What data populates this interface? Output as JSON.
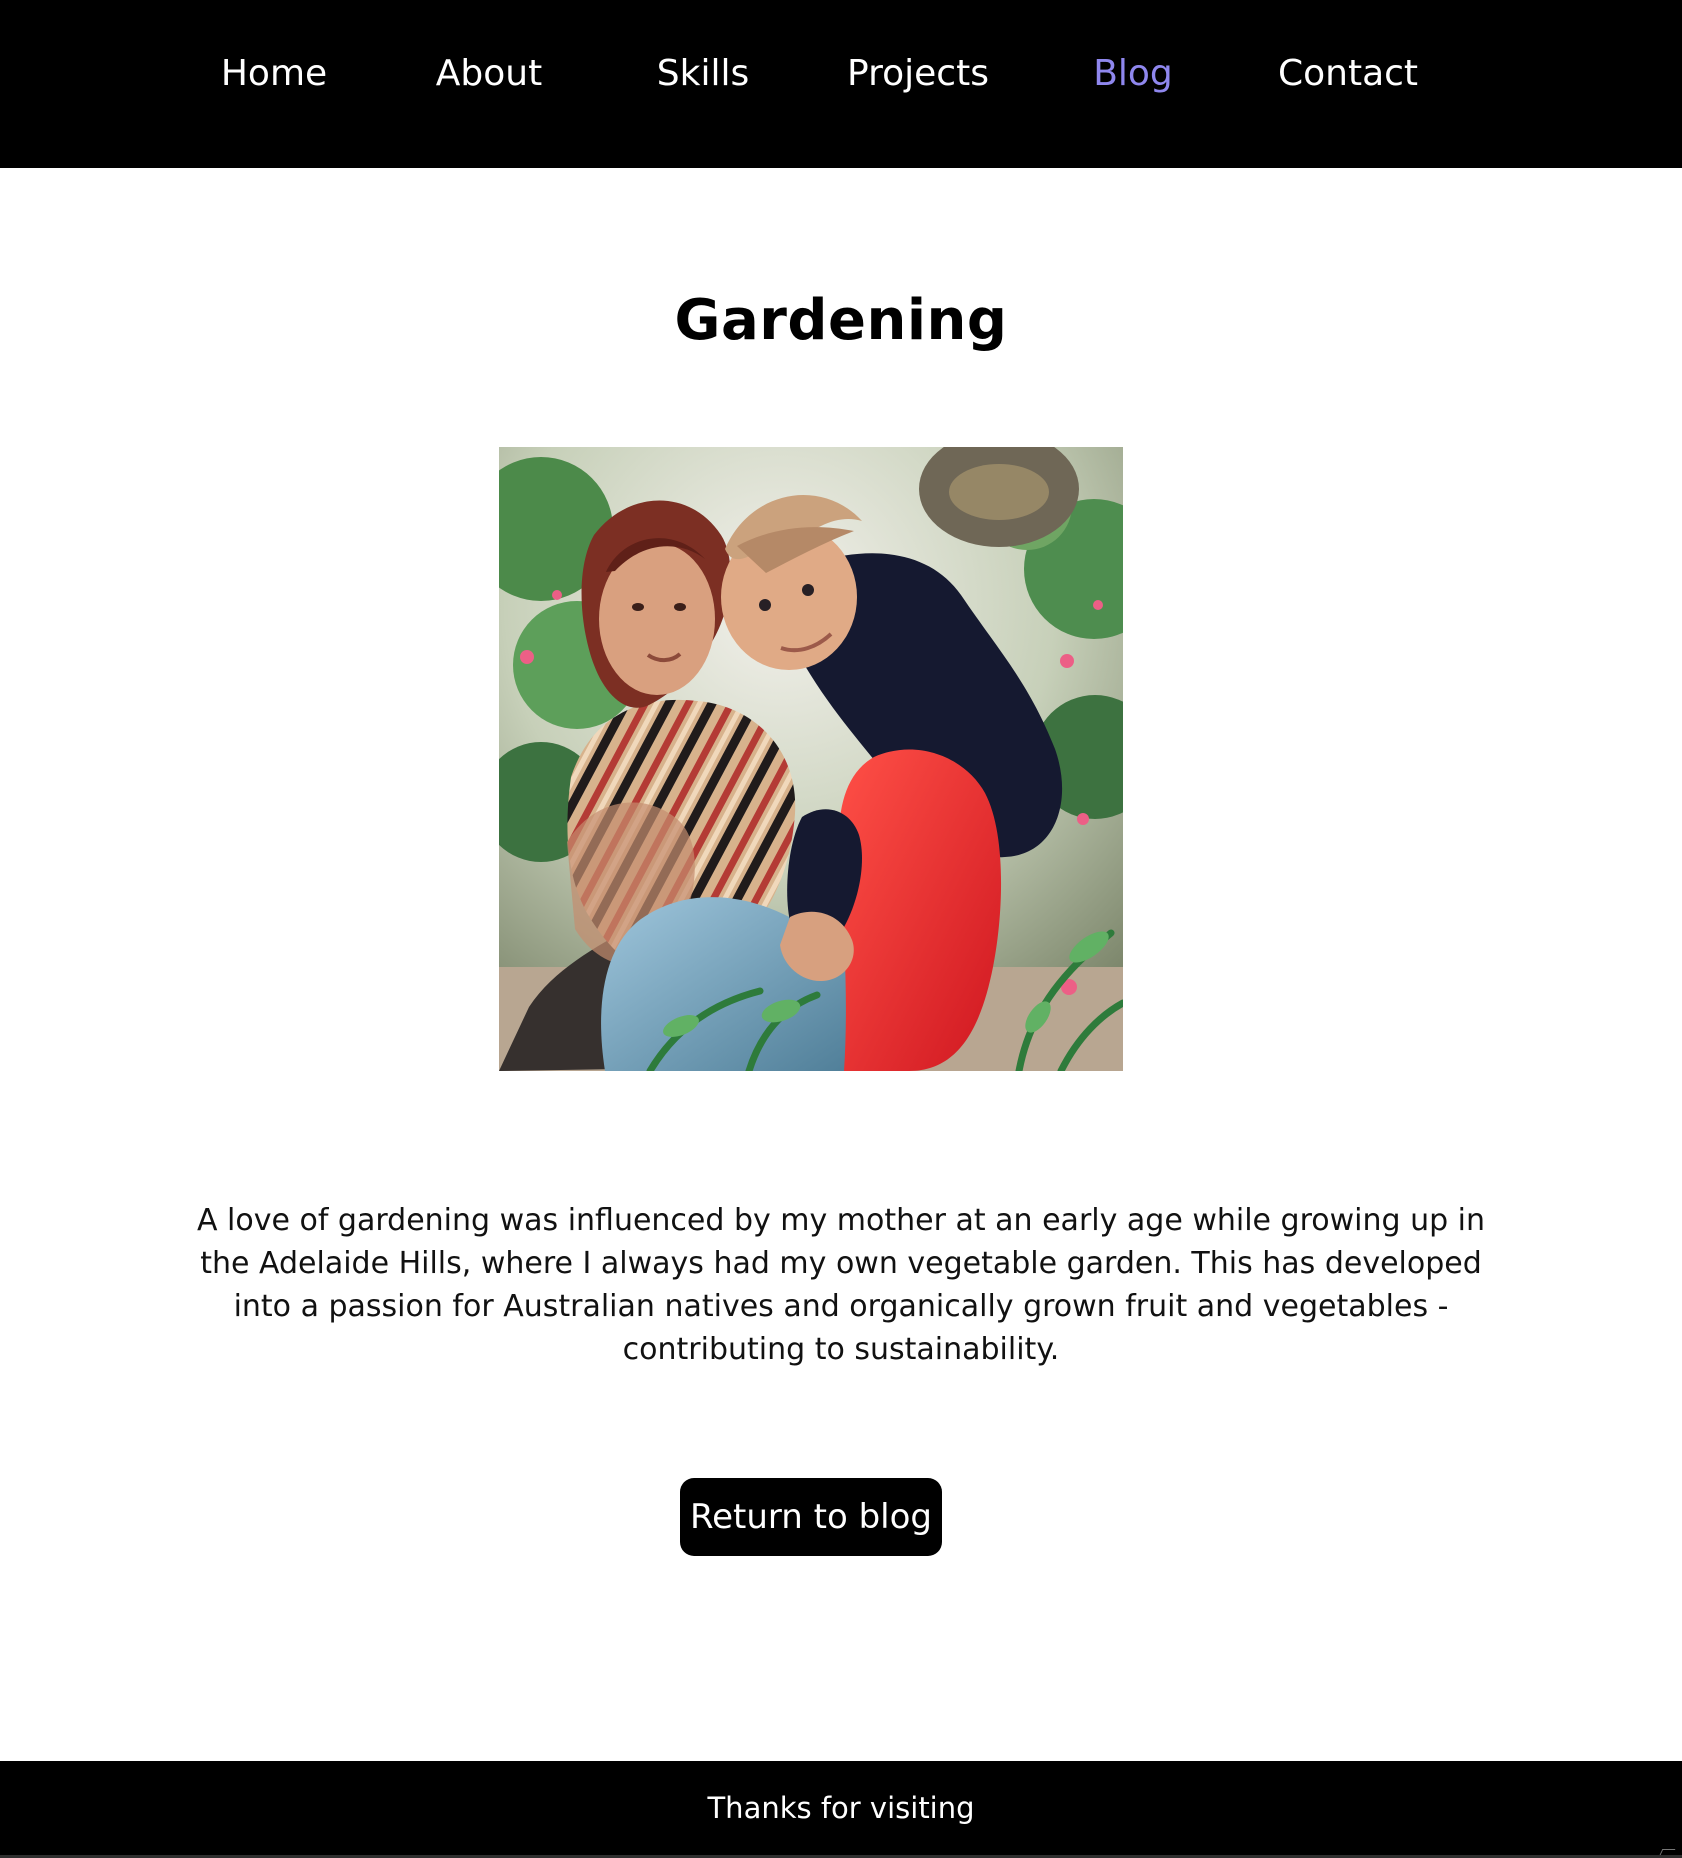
{
  "nav": {
    "items": [
      {
        "label": "Home",
        "active": false
      },
      {
        "label": "About",
        "active": false
      },
      {
        "label": "Skills",
        "active": false
      },
      {
        "label": "Projects",
        "active": false
      },
      {
        "label": "Blog",
        "active": true
      },
      {
        "label": "Contact",
        "active": false
      }
    ],
    "active_color": "#8f87ee"
  },
  "page": {
    "title": "Gardening",
    "body": "A love of gardening was influenced by my mother at an early age while growing up in the Adelaide Hills, where I always had my own vegetable garden. This has developed into a passion for Australian natives and organically grown fruit and vegetables - contributing to sustainability.",
    "return_button_label": "Return to blog"
  },
  "footer": {
    "text": "Thanks for visiting"
  },
  "colors": {
    "nav_background": "#000000",
    "page_background": "#ffffff",
    "button_background": "#000000",
    "footer_background": "#000000"
  }
}
